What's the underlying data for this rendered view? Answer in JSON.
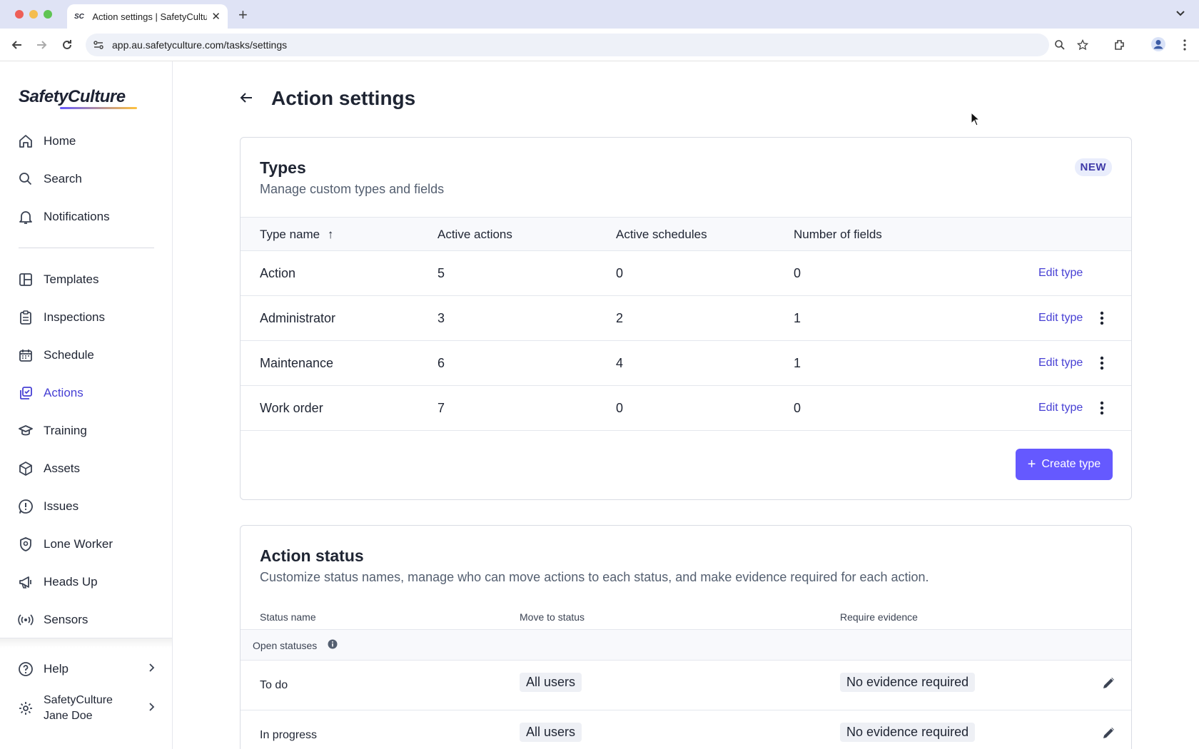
{
  "browser": {
    "tab_title": "Action settings | SafetyCulture",
    "favicon_text": "SC",
    "url": "app.au.safetyculture.com/tasks/settings"
  },
  "sidebar": {
    "logo": "SafetyCulture",
    "items": [
      {
        "label": "Home",
        "icon": "home-icon"
      },
      {
        "label": "Search",
        "icon": "search-icon"
      },
      {
        "label": "Notifications",
        "icon": "bell-icon"
      },
      {
        "label": "Templates",
        "icon": "templates-icon"
      },
      {
        "label": "Inspections",
        "icon": "clipboard-icon"
      },
      {
        "label": "Schedule",
        "icon": "calendar-icon"
      },
      {
        "label": "Actions",
        "icon": "actions-icon",
        "active": true
      },
      {
        "label": "Training",
        "icon": "graduation-cap-icon"
      },
      {
        "label": "Assets",
        "icon": "cube-icon"
      },
      {
        "label": "Issues",
        "icon": "alert-icon"
      },
      {
        "label": "Lone Worker",
        "icon": "shield-pin-icon"
      },
      {
        "label": "Heads Up",
        "icon": "megaphone-icon"
      },
      {
        "label": "Sensors",
        "icon": "sensor-icon"
      }
    ],
    "help_label": "Help",
    "profile": {
      "org": "SafetyCulture",
      "user": "Jane Doe"
    }
  },
  "page": {
    "title": "Action settings"
  },
  "types_card": {
    "title": "Types",
    "subtitle": "Manage custom types and fields",
    "badge": "NEW",
    "columns": [
      "Type name",
      "Active actions",
      "Active schedules",
      "Number of fields"
    ],
    "sort_indicator": "↑",
    "rows": [
      {
        "name": "Action",
        "active_actions": "5",
        "active_schedules": "0",
        "fields": "0",
        "edit": "Edit type",
        "has_menu": false
      },
      {
        "name": "Administrator",
        "active_actions": "3",
        "active_schedules": "2",
        "fields": "1",
        "edit": "Edit type",
        "has_menu": true
      },
      {
        "name": "Maintenance",
        "active_actions": "6",
        "active_schedules": "4",
        "fields": "1",
        "edit": "Edit type",
        "has_menu": true
      },
      {
        "name": "Work order",
        "active_actions": "7",
        "active_schedules": "0",
        "fields": "0",
        "edit": "Edit type",
        "has_menu": true
      }
    ],
    "create_button": "Create type"
  },
  "status_card": {
    "title": "Action status",
    "subtitle": "Customize status names, manage who can move actions to each status, and make evidence required for each action.",
    "columns": [
      "Status name",
      "Move to status",
      "Require evidence"
    ],
    "group_label": "Open statuses",
    "rows": [
      {
        "name": "To do",
        "move_to": "All users",
        "evidence": "No evidence required"
      },
      {
        "name": "In progress",
        "move_to": "All users",
        "evidence": "No evidence required"
      }
    ]
  },
  "colors": {
    "accent": "#6559ff",
    "link": "#4740d4",
    "tabstrip": "#dfe3f5"
  }
}
